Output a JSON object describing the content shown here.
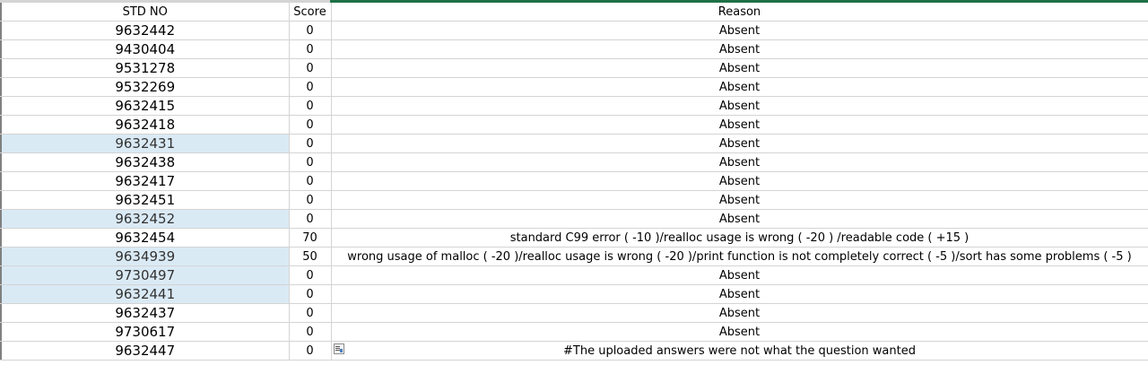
{
  "headers": {
    "std_no": "STD NO",
    "score": "Score",
    "reason": "Reason"
  },
  "rows": [
    {
      "std": "9632442",
      "score": "0",
      "reason": "Absent",
      "highlight": false
    },
    {
      "std": "9430404",
      "score": "0",
      "reason": "Absent",
      "highlight": false
    },
    {
      "std": "9531278",
      "score": "0",
      "reason": "Absent",
      "highlight": false
    },
    {
      "std": "9532269",
      "score": "0",
      "reason": "Absent",
      "highlight": false
    },
    {
      "std": "9632415",
      "score": "0",
      "reason": "Absent",
      "highlight": false
    },
    {
      "std": "9632418",
      "score": "0",
      "reason": "Absent",
      "highlight": false
    },
    {
      "std": "9632431",
      "score": "0",
      "reason": "Absent",
      "highlight": true
    },
    {
      "std": "9632438",
      "score": "0",
      "reason": "Absent",
      "highlight": false
    },
    {
      "std": "9632417",
      "score": "0",
      "reason": "Absent",
      "highlight": false
    },
    {
      "std": "9632451",
      "score": "0",
      "reason": "Absent",
      "highlight": false
    },
    {
      "std": "9632452",
      "score": "0",
      "reason": "Absent",
      "highlight": true
    },
    {
      "std": "9632454",
      "score": "70",
      "reason": "standard C99 error ( -10 )/realloc usage is wrong ( -20 ) /readable code ( +15 )",
      "highlight": false
    },
    {
      "std": "9634939",
      "score": "50",
      "reason": "wrong usage of malloc ( -20 )/realloc usage is wrong ( -20 )/print function is not completely correct ( -5 )/sort has some problems ( -5 )",
      "highlight": true
    },
    {
      "std": "9730497",
      "score": "0",
      "reason": "Absent",
      "highlight": true
    },
    {
      "std": "9632441",
      "score": "0",
      "reason": "Absent",
      "highlight": true
    },
    {
      "std": "9632437",
      "score": "0",
      "reason": "Absent",
      "highlight": false
    },
    {
      "std": "9730617",
      "score": "0",
      "reason": "Absent",
      "highlight": false
    },
    {
      "std": "9632447",
      "score": "0",
      "reason": "#The uploaded answers were not what the question wanted",
      "highlight": false,
      "note_icon": "comment-indicator-icon"
    }
  ]
}
